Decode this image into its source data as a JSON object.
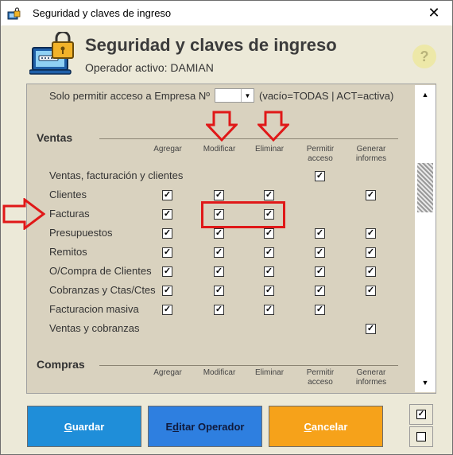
{
  "window": {
    "title": "Seguridad y claves de ingreso",
    "close_glyph": "✕"
  },
  "header": {
    "title": "Seguridad y claves de ingreso",
    "operator": "Operador activo: DAMIAN",
    "help_glyph": "?"
  },
  "empresa": {
    "label": "Solo permitir acceso a Empresa Nº",
    "value": "",
    "hint": "(vacío=TODAS | ACT=activa)"
  },
  "columns": [
    "Agregar",
    "Modificar",
    "Eliminar",
    "Permitir acceso",
    "Generar informes"
  ],
  "sections": {
    "ventas": {
      "title": "Ventas",
      "rows": [
        {
          "label": "Ventas, facturación y clientes",
          "checks": [
            null,
            null,
            null,
            true,
            null
          ]
        },
        {
          "label": "Clientes",
          "checks": [
            true,
            true,
            true,
            null,
            true
          ]
        },
        {
          "label": "Facturas",
          "checks": [
            true,
            true,
            true,
            null,
            null
          ]
        },
        {
          "label": "Presupuestos",
          "checks": [
            true,
            true,
            true,
            true,
            true
          ]
        },
        {
          "label": "Remitos",
          "checks": [
            true,
            true,
            true,
            true,
            true
          ]
        },
        {
          "label": "O/Compra de Clientes",
          "checks": [
            true,
            true,
            true,
            true,
            true
          ]
        },
        {
          "label": "Cobranzas y Ctas/Ctes",
          "checks": [
            true,
            true,
            true,
            true,
            true
          ]
        },
        {
          "label": "Facturacion masiva",
          "checks": [
            true,
            true,
            true,
            true,
            null
          ]
        },
        {
          "label": "Ventas y cobranzas",
          "checks": [
            null,
            null,
            null,
            null,
            true
          ]
        }
      ]
    },
    "compras": {
      "title": "Compras",
      "columns": [
        "Agregar",
        "Modificar",
        "Eliminar",
        "Permitir acceso",
        "Generar informes"
      ]
    }
  },
  "buttons": {
    "guardar_first": "G",
    "guardar_rest": "uardar",
    "editar_pre": "E",
    "editar_ul": "d",
    "editar_rest": "itar Operador",
    "cancelar_first": "C",
    "cancelar_rest": "ancelar",
    "check_all_glyph": "✓",
    "uncheck_all_glyph": ""
  },
  "colors": {
    "annotation_red": "#e01818",
    "guardar": "#1f8ed9",
    "editar": "#2e7fe0",
    "cancelar": "#f6a21a",
    "panel_bg": "#d9d2bf"
  }
}
